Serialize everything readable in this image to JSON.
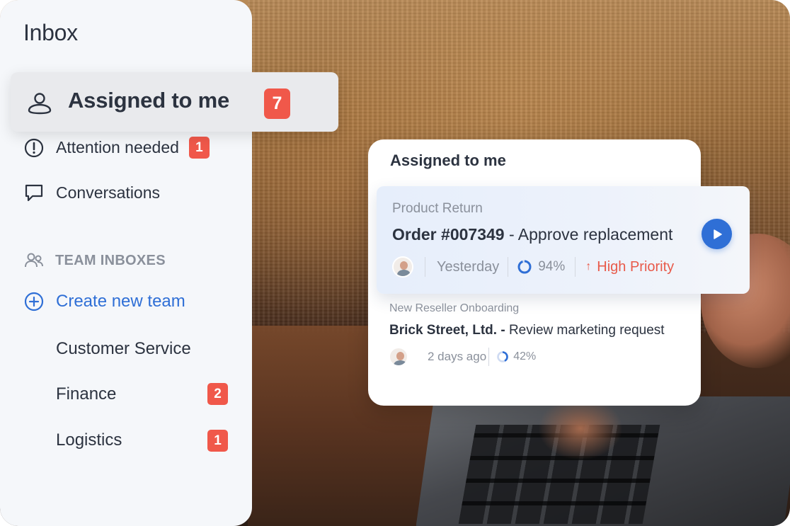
{
  "sidebar": {
    "title": "Inbox",
    "assigned": {
      "label": "Assigned to me",
      "badge": "7"
    },
    "items": [
      {
        "label": "Attention needed",
        "badge": "1"
      },
      {
        "label": "Conversations"
      }
    ],
    "team_header": "TEAM INBOXES",
    "create_team": "Create new team",
    "teams": [
      {
        "label": "Customer Service"
      },
      {
        "label": "Finance",
        "badge": "2"
      },
      {
        "label": "Logistics",
        "badge": "1"
      }
    ]
  },
  "card": {
    "title": "Assigned to me",
    "tasks": [
      {
        "category": "Product Return",
        "order": "Order #007349",
        "separator": "-",
        "action": "Approve replacement",
        "time": "Yesterday",
        "progress": "94%",
        "priority": "High Priority"
      },
      {
        "category": "New Reseller Onboarding",
        "order": "Brick Street, Ltd.",
        "separator": "-",
        "action": "Review marketing request",
        "time": "2 days ago",
        "progress": "42%"
      }
    ]
  },
  "colors": {
    "accent": "#2f6fd6",
    "badge": "#f0584a",
    "priority": "#e85a4a",
    "sidebar_bg": "#f5f7fa"
  }
}
